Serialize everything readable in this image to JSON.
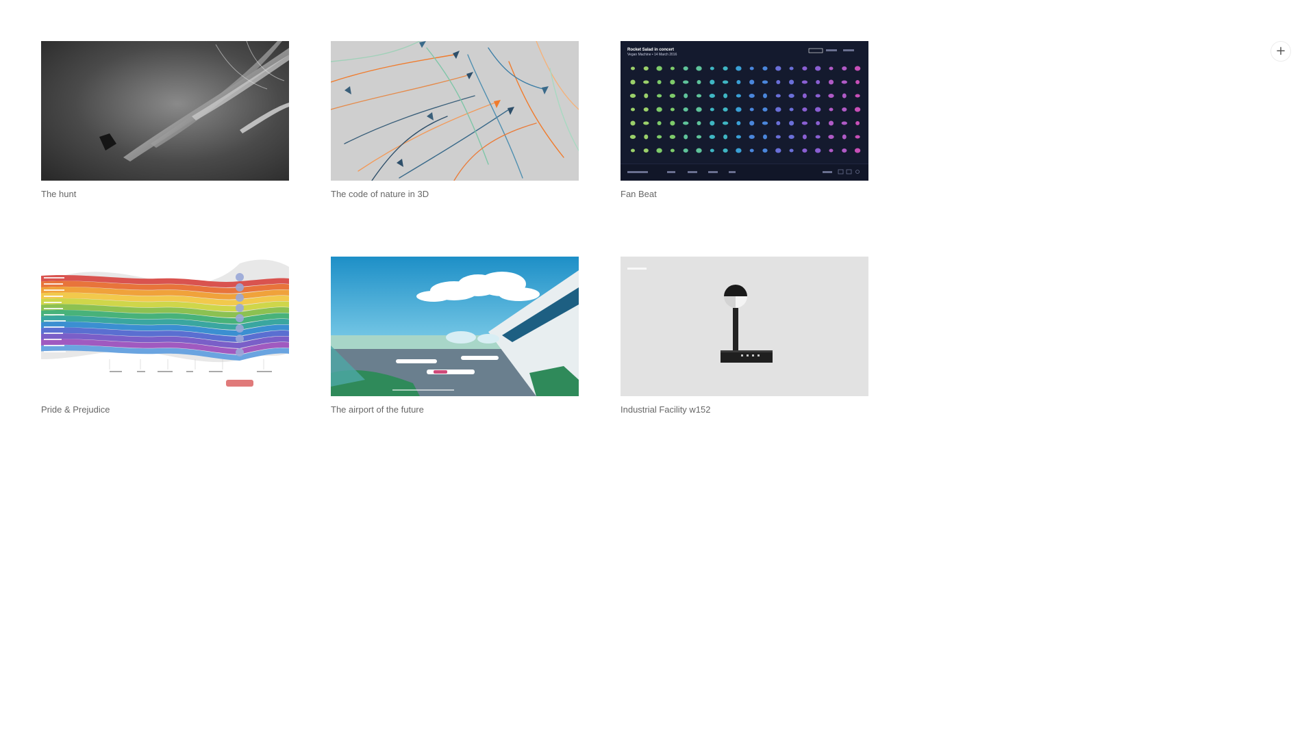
{
  "add_button": {
    "icon": "plus-icon",
    "symbol": "+"
  },
  "cards": [
    {
      "title": "The hunt"
    },
    {
      "title": "The code of nature in 3D"
    },
    {
      "title": "Fan Beat",
      "thumbnail_title": "Rocket Salad in concert",
      "thumbnail_subtitle": "Vegan Machine • 14 March 2016"
    },
    {
      "title": "Pride & Prejudice"
    },
    {
      "title": "The airport of the future"
    },
    {
      "title": "Industrial Facility w152"
    }
  ]
}
